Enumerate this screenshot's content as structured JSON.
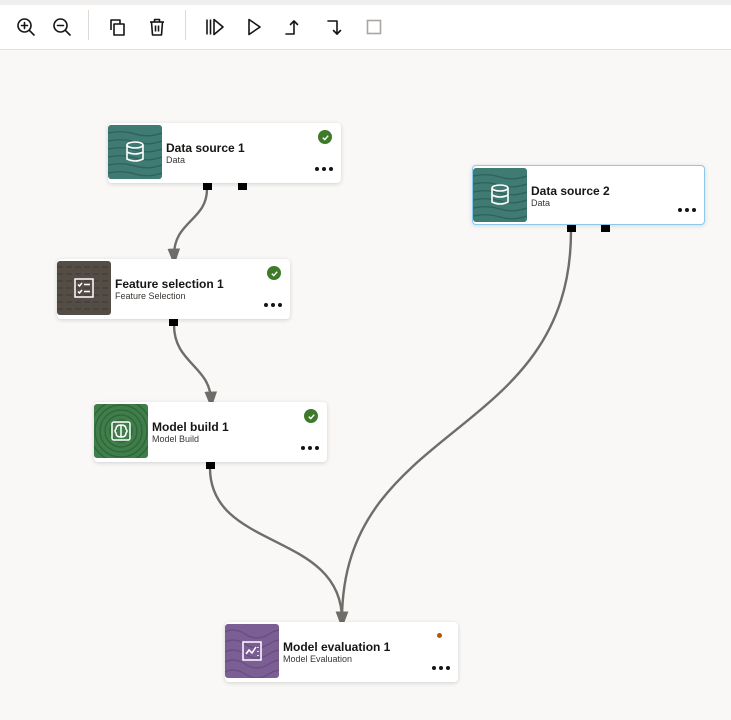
{
  "toolbar": {
    "buttons": [
      {
        "name": "zoom-in-button",
        "icon": "zoom-in-icon",
        "tooltip": "Zoom In"
      },
      {
        "name": "zoom-out-button",
        "icon": "zoom-out-icon",
        "tooltip": "Zoom Out"
      },
      {
        "name": "copy-button",
        "icon": "copy-icon",
        "tooltip": "Copy"
      },
      {
        "name": "delete-button",
        "icon": "trash-icon",
        "tooltip": "Delete"
      },
      {
        "name": "run-all-button",
        "icon": "run-all-icon",
        "tooltip": "Run All"
      },
      {
        "name": "run-button",
        "icon": "play-icon",
        "tooltip": "Run"
      },
      {
        "name": "run-to-node-button",
        "icon": "step-up-icon",
        "tooltip": "Run to Node"
      },
      {
        "name": "run-from-node-button",
        "icon": "step-down-icon",
        "tooltip": "Run from Node"
      },
      {
        "name": "stop-button",
        "icon": "stop-icon",
        "tooltip": "Stop"
      }
    ]
  },
  "nodes": {
    "data_source_1": {
      "title": "Data source 1",
      "subtitle": "Data",
      "status": "complete",
      "icon": "database-icon",
      "color": "#3f7a73"
    },
    "data_source_2": {
      "title": "Data source 2",
      "subtitle": "Data",
      "status": "none",
      "icon": "database-icon",
      "color": "#3f7a73",
      "selected": true
    },
    "feature_selection_1": {
      "title": "Feature selection 1",
      "subtitle": "Feature Selection",
      "status": "complete",
      "icon": "checklist-icon",
      "color": "#544d46"
    },
    "model_build_1": {
      "title": "Model build 1",
      "subtitle": "Model Build",
      "status": "complete",
      "icon": "brain-chip-icon",
      "color": "#3f7d4a"
    },
    "model_evaluation_1": {
      "title": "Model evaluation 1",
      "subtitle": "Model Evaluation",
      "status": "pending",
      "icon": "chart-report-icon",
      "color": "#7b5e93"
    }
  },
  "colors": {
    "success": "#3d7a2a",
    "pending": "#b05a00",
    "link": "#6f6c69",
    "selection": "#8ec7e8"
  }
}
